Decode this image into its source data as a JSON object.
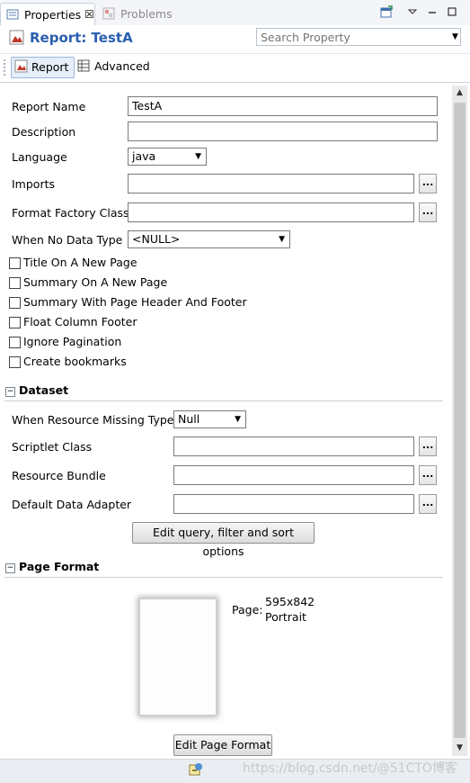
{
  "tabs": [
    {
      "label": "Properties",
      "close": "☒"
    },
    {
      "label": "Problems"
    }
  ],
  "header": {
    "title": "Report: TestA",
    "search_placeholder": "Search Property"
  },
  "toolbar": {
    "report_label": "Report",
    "advanced_label": "Advanced"
  },
  "form": {
    "report_name_label": "Report Name",
    "report_name_value": "TestA",
    "description_label": "Description",
    "description_value": "",
    "language_label": "Language",
    "language_value": "java",
    "imports_label": "Imports",
    "format_factory_label": "Format Factory Class",
    "when_no_data_label": "When No Data Type",
    "when_no_data_value": "<NULL>",
    "browse_label": "...",
    "checkboxes": [
      {
        "label": "Title On A New Page",
        "checked": false
      },
      {
        "label": "Summary On A New Page",
        "checked": false
      },
      {
        "label": "Summary With Page Header And Footer",
        "checked": false
      },
      {
        "label": "Float Column Footer",
        "checked": false
      },
      {
        "label": "Ignore Pagination",
        "checked": false
      },
      {
        "label": "Create bookmarks",
        "checked": false
      }
    ]
  },
  "dataset": {
    "title": "Dataset",
    "toggle": "−",
    "resource_missing_label": "When Resource Missing Type",
    "resource_missing_value": "Null",
    "scriptlet_label": "Scriptlet Class",
    "resource_bundle_label": "Resource Bundle",
    "data_adapter_label": "Default Data Adapter",
    "edit_query_button": "Edit query, filter and sort options"
  },
  "page_format": {
    "title": "Page Format",
    "toggle": "−",
    "page_label": "Page:",
    "size": "595x842",
    "orientation": "Portrait",
    "edit_button": "Edit Page Format"
  },
  "status": {
    "watermark": "https://blog.csdn.net/@51CTO博客"
  },
  "colors": {
    "accent": "#2a5faf",
    "search_text": "#3d6fb5"
  }
}
